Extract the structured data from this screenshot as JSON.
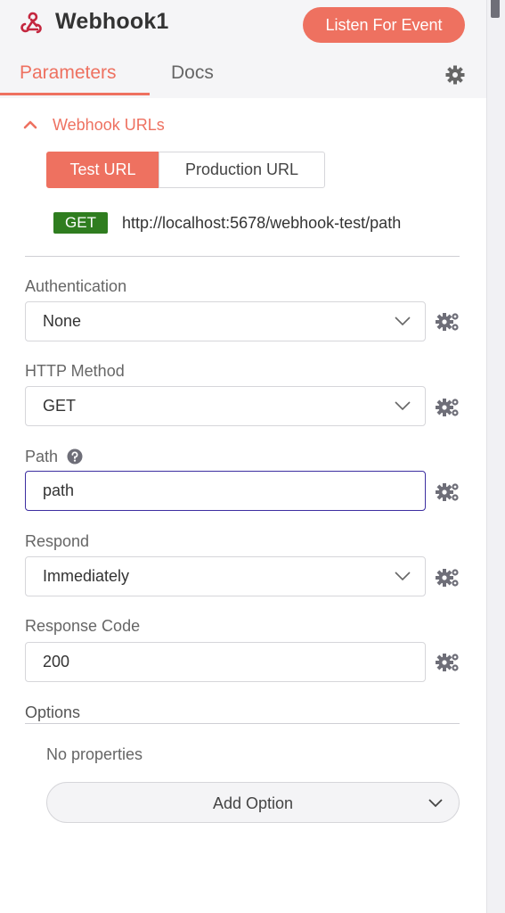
{
  "header": {
    "node_name": "Webhook1",
    "listen_button": "Listen For Event",
    "tabs": [
      {
        "label": "Parameters",
        "active": true
      },
      {
        "label": "Docs",
        "active": false
      }
    ]
  },
  "webhook_urls": {
    "section_title": "Webhook URLs",
    "toggle": [
      "Test URL",
      "Production URL"
    ],
    "selected_toggle": "Test URL",
    "method_badge": "GET",
    "url": "http://localhost:5678/webhook-test/path"
  },
  "fields": {
    "authentication": {
      "label": "Authentication",
      "value": "None"
    },
    "http_method": {
      "label": "HTTP Method",
      "value": "GET"
    },
    "path": {
      "label": "Path",
      "value": "path"
    },
    "respond": {
      "label": "Respond",
      "value": "Immediately"
    },
    "response_code": {
      "label": "Response Code",
      "value": "200"
    }
  },
  "options": {
    "title": "Options",
    "empty_text": "No properties",
    "add_button": "Add Option"
  },
  "colors": {
    "accent": "#ee7160",
    "badge_green": "#2f7d1f",
    "focus_border": "#3c2ea0"
  }
}
